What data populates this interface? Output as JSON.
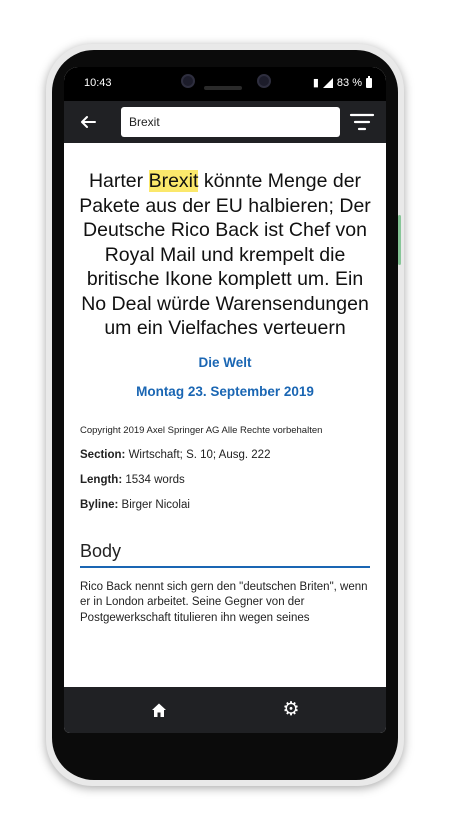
{
  "status_bar": {
    "time": "10:43",
    "battery": "83 %"
  },
  "search": {
    "value": "Brexit",
    "placeholder": ""
  },
  "article": {
    "title_highlight": "Brexit",
    "title_pre": "Harter ",
    "title_post": " könnte Menge der Pakete aus der EU halbieren; Der Deutsche Rico Back ist Chef von Royal Mail und krempelt die britische Ikone komplett um. Ein No Deal würde Warensendungen um ein Vielfaches verteuern",
    "source": "Die Welt",
    "date": "Montag 23. September 2019",
    "copyright": "Copyright 2019 Axel Springer AG Alle Rechte vorbehalten",
    "section_label": "Section:",
    "section_value": " Wirtschaft; S. 10; Ausg. 222",
    "length_label": "Length:",
    "length_value": " 1534 words",
    "byline_label": "Byline:",
    "byline_value": " Birger Nicolai",
    "body_heading": "Body",
    "body_text": "Rico Back nennt sich gern den \"deutschen Briten\", wenn er in London arbeitet. Seine Gegner von der Postgewerkschaft titulieren ihn wegen seines"
  },
  "colors": {
    "accent": "#1a66b3",
    "highlight": "#fbe86b",
    "bar": "#202124"
  },
  "icons": {
    "back": "arrow-left-icon",
    "filter": "filter-icon",
    "home": "home-icon",
    "settings": "gear-icon"
  }
}
